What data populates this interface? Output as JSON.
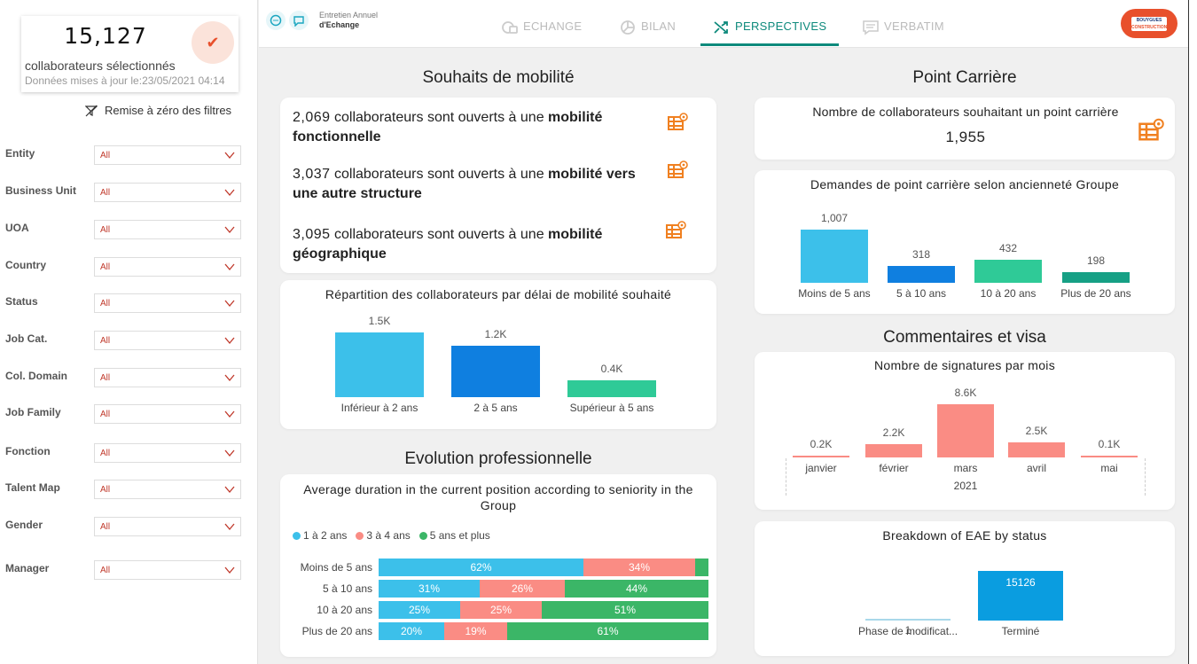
{
  "sidebar": {
    "count": "15,127",
    "count_label": "collaborateurs sélectionnés",
    "updated": "Données mises à jour le:23/05/2021 04:14",
    "reset_label": "Remise à zéro des filtres",
    "filters": [
      {
        "label": "Entity",
        "value": "All"
      },
      {
        "label": "Business Unit",
        "value": "All"
      },
      {
        "label": "UOA",
        "value": "All"
      },
      {
        "label": "Country",
        "value": "All"
      },
      {
        "label": "Status",
        "value": "All"
      },
      {
        "label": "Job Cat.",
        "value": "All"
      },
      {
        "label": "Col. Domain",
        "value": "All"
      },
      {
        "label": "Job Family",
        "value": "All"
      },
      {
        "label": "Fonction",
        "value": "All"
      },
      {
        "label": "Talent Map",
        "value": "All"
      },
      {
        "label": "Gender",
        "value": "All"
      },
      {
        "label": "Manager",
        "value": "All"
      }
    ]
  },
  "header": {
    "logo_line1": "Entretien Annuel",
    "logo_line2": "d'Echange",
    "tabs": [
      {
        "label": "ECHANGE",
        "icon": "exchange-icon",
        "active": false
      },
      {
        "label": "BILAN",
        "icon": "pie-chart-icon",
        "active": true
      },
      {
        "label": "PERSPECTIVES",
        "icon": "shuffle-icon",
        "active": true
      },
      {
        "label": "VERBATIM",
        "icon": "message-icon",
        "active": false
      }
    ],
    "brand_line1": "BOUYGUES",
    "brand_line2": "CONSTRUCTION"
  },
  "colors": {
    "accent": "#0e8a7c",
    "orange": "#e8502c",
    "blue": "#3cc0ea",
    "dark_blue": "#0f7fe0",
    "green": "#2fca97",
    "salmon": "#fa8c84",
    "stack_green": "#3bb667"
  },
  "mobility": {
    "title": "Souhaits de mobilité",
    "rows": [
      {
        "num": "2,069",
        "text": "collaborateurs sont ouverts à une ",
        "bold": "mobilité fonctionnelle"
      },
      {
        "num": "3,037",
        "text": "collaborateurs sont ouverts à une ",
        "bold": "mobilité vers une autre structure"
      },
      {
        "num": "3,095",
        "text": "collaborateurs sont ouverts à une ",
        "bold": "mobilité géographique"
      }
    ]
  },
  "career": {
    "title": "Point Carrière",
    "kpi_label": "Nombre de collaborateurs souhaitant un point carrière",
    "kpi_value": "1,955"
  },
  "comments": {
    "title": "Commentaires et visa"
  },
  "evolution": {
    "title": "Evolution professionnelle"
  },
  "chart_data": [
    {
      "id": "delai",
      "type": "bar",
      "title": "Répartition des collaborateurs par délai de mobilité souhaité",
      "categories": [
        "Inférieur à 2 ans",
        "2 à 5 ans",
        "Supérieur à 5 ans"
      ],
      "values": [
        1500,
        1200,
        400
      ],
      "labels": [
        "1.5K",
        "1.2K",
        "0.4K"
      ],
      "colors": [
        "#3cc0ea",
        "#0f7fe0",
        "#2fca97"
      ]
    },
    {
      "id": "anciennete",
      "type": "bar",
      "title": "Demandes de point carrière selon ancienneté Groupe",
      "categories": [
        "Moins de 5 ans",
        "5 à 10 ans",
        "10 à 20 ans",
        "Plus de 20 ans"
      ],
      "values": [
        1007,
        318,
        432,
        198
      ],
      "labels": [
        "1,007",
        "318",
        "432",
        "198"
      ],
      "colors": [
        "#3cc0ea",
        "#0f7fe0",
        "#2fca97",
        "#16a085"
      ]
    },
    {
      "id": "signatures",
      "type": "bar",
      "title": "Nombre de signatures par mois",
      "categories": [
        "janvier",
        "février",
        "mars",
        "avril",
        "mai"
      ],
      "values": [
        200,
        2200,
        8600,
        2500,
        100
      ],
      "labels": [
        "0.2K",
        "2.2K",
        "8.6K",
        "2.5K",
        "0.1K"
      ],
      "x_group_label": "2021",
      "color": "#fa8c84"
    },
    {
      "id": "status",
      "type": "bar",
      "title": "Breakdown of EAE by status",
      "categories": [
        "Phase de modificat...",
        "Terminé"
      ],
      "values": [
        1,
        15126
      ],
      "labels": [
        "1",
        "15126"
      ],
      "color": "#0a9de0"
    },
    {
      "id": "duration",
      "type": "bar",
      "stacked": true,
      "title": "Average duration in the current position according to seniority in the Group",
      "legend": [
        "1 à 2 ans",
        "3 à 4 ans",
        "5 ans et plus"
      ],
      "categories": [
        "Moins de 5 ans",
        "5 à 10 ans",
        "10 à 20 ans",
        "Plus de 20 ans"
      ],
      "series": [
        {
          "name": "1 à 2 ans",
          "color": "#3cc0ea",
          "values": [
            62,
            31,
            25,
            20
          ]
        },
        {
          "name": "3 à 4 ans",
          "color": "#fa8c84",
          "values": [
            34,
            26,
            25,
            19
          ]
        },
        {
          "name": "5 ans et plus",
          "color": "#3bb667",
          "values": [
            4,
            44,
            51,
            61
          ]
        }
      ],
      "value_labels": [
        [
          "62%",
          "34%",
          ""
        ],
        [
          "31%",
          "26%",
          "44%"
        ],
        [
          "25%",
          "25%",
          "51%"
        ],
        [
          "20%",
          "19%",
          "61%"
        ]
      ]
    }
  ]
}
